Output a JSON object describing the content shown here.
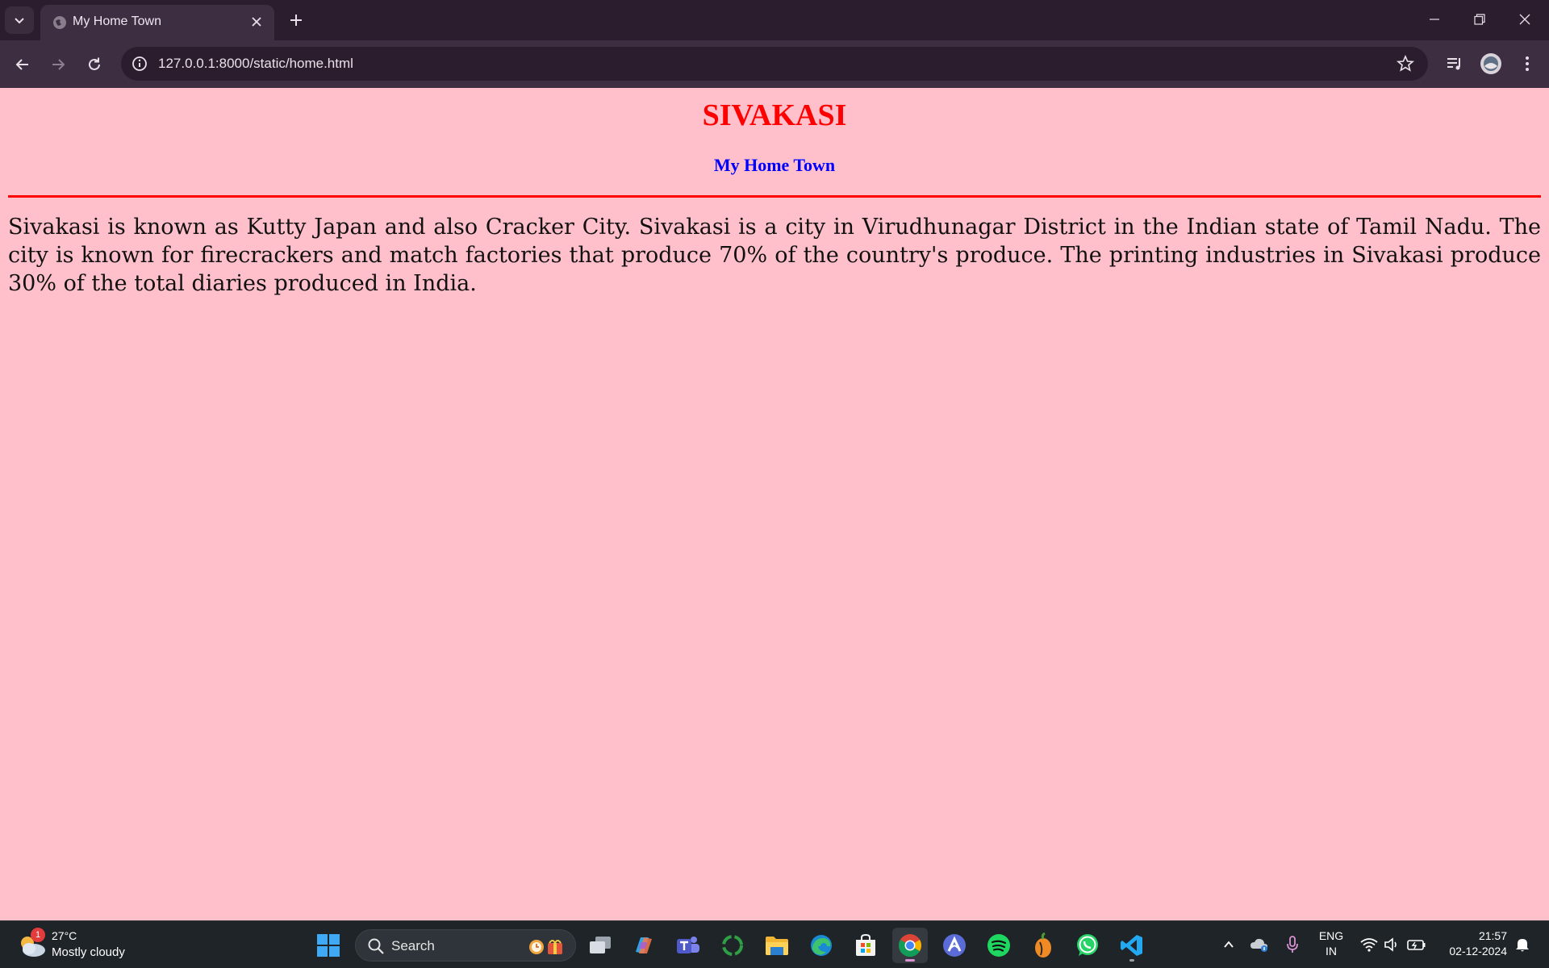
{
  "browser": {
    "tab_title": "My Home Town",
    "url": "127.0.0.1:8000/static/home.html"
  },
  "page": {
    "heading": "SIVAKASI",
    "subheading": "My Home Town",
    "paragraph": "Sivakasi is known as Kutty Japan and also Cracker City. Sivakasi is a city in Virudhunagar District in the Indian state of Tamil Nadu. The city is known for firecrackers and match factories that produce 70% of the country's produce. The printing industries in Sivakasi produce 30% of the total diaries produced in India.",
    "colors": {
      "background": "#ffc0cb",
      "heading": "#ff0000",
      "subheading": "#0000ff",
      "rule": "#ff0000"
    }
  },
  "taskbar": {
    "weather": {
      "badge": "1",
      "temperature": "27°C",
      "condition": "Mostly cloudy"
    },
    "search_label": "Search",
    "apps": [
      "windows-start",
      "task-view",
      "copilot",
      "teams",
      "circle-app",
      "file-explorer",
      "edge",
      "microsoft-store",
      "chrome",
      "arc-app",
      "spotify",
      "fl-studio",
      "whatsapp",
      "vs-code"
    ],
    "language": {
      "line1": "ENG",
      "line2": "IN"
    },
    "time": "21:57",
    "date": "02-12-2024"
  }
}
